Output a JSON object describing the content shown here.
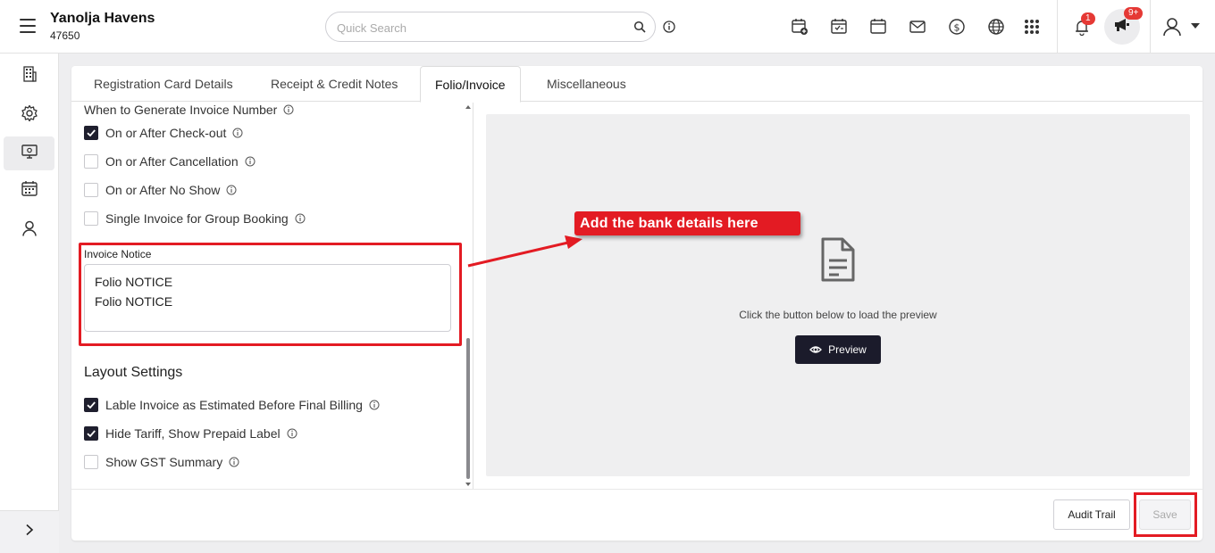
{
  "header": {
    "property_name": "Yanolja Havens",
    "property_id": "47650",
    "search_placeholder": "Quick Search",
    "notifications_count": "1",
    "announcements_count": "9+"
  },
  "tabs": [
    {
      "label": "Registration Card Details"
    },
    {
      "label": "Receipt & Credit Notes"
    },
    {
      "label": "Folio/Invoice"
    },
    {
      "label": "Miscellaneous"
    }
  ],
  "invoice_number": {
    "title": "When to Generate Invoice Number",
    "options": [
      {
        "label": "On or After Check-out",
        "checked": true
      },
      {
        "label": "On or After Cancellation",
        "checked": false
      },
      {
        "label": "On or After No Show",
        "checked": false
      },
      {
        "label": "Single Invoice for Group Booking",
        "checked": false
      }
    ]
  },
  "invoice_notice": {
    "label": "Invoice Notice",
    "line1": "Folio NOTICE",
    "line2": "Folio NOTICE"
  },
  "layout_settings": {
    "title": "Layout Settings",
    "options": [
      {
        "label": "Lable Invoice as Estimated Before Final Billing",
        "checked": true
      },
      {
        "label": "Hide Tariff, Show Prepaid Label",
        "checked": true
      },
      {
        "label": "Show GST Summary",
        "checked": false
      }
    ]
  },
  "preview": {
    "message": "Click the button below to load the preview",
    "button_label": "Preview"
  },
  "annotation": {
    "callout_text": "Add the bank details here"
  },
  "footer": {
    "audit_label": "Audit Trail",
    "save_label": "Save"
  },
  "colors": {
    "accent_dark": "#1b1b2b",
    "annotation_red": "#e31b23",
    "badge_red": "#e53935"
  }
}
